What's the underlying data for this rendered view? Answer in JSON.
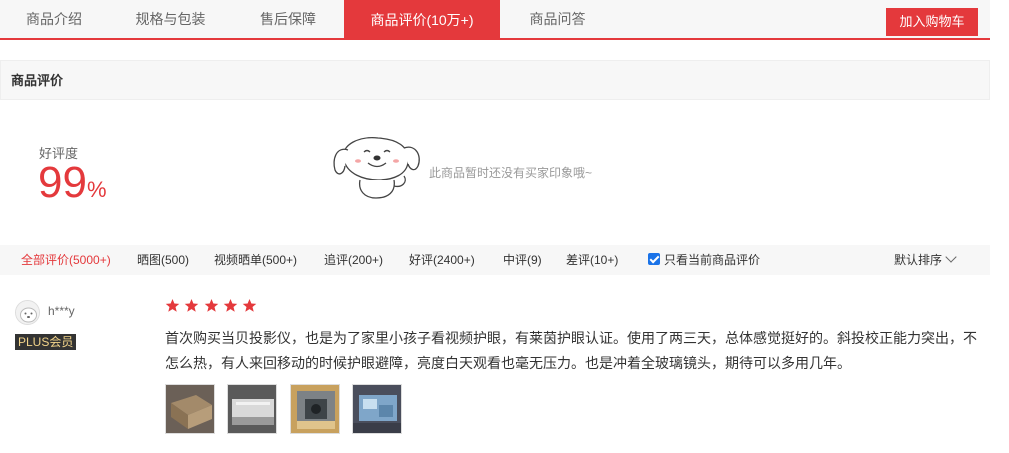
{
  "tabs": [
    {
      "label": "商品介绍"
    },
    {
      "label": "规格与包装"
    },
    {
      "label": "售后保障"
    },
    {
      "label": "商品评价(10万+)"
    },
    {
      "label": "商品问答"
    }
  ],
  "cart_button": "加入购物车",
  "section_title": "商品评价",
  "rating": {
    "label": "好评度",
    "value": "99",
    "unit": "%"
  },
  "impression_text": "此商品暂时还没有买家印象哦~",
  "filters": [
    {
      "label": "全部评价(5000+)"
    },
    {
      "label": "晒图(500)"
    },
    {
      "label": "视频晒单(500+)"
    },
    {
      "label": "追评(200+)"
    },
    {
      "label": "好评(2400+)"
    },
    {
      "label": "中评(9)"
    },
    {
      "label": "差评(10+)"
    }
  ],
  "only_current_label": "只看当前商品评价",
  "sort_label": "默认排序",
  "review": {
    "username": "h***y",
    "badge": "PLUS会员",
    "stars": 5,
    "text": "首次购买当贝投影仪，也是为了家里小孩子看视频护眼，有莱茵护眼认证。使用了两三天，总体感觉挺好的。斜投校正能力突出，不怎么热，有人来回移动的时候护眼避障，亮度白天观看也毫无压力。也是冲着全玻璃镜头，期待可以多用几年。",
    "photo_count": 4
  },
  "colors": {
    "accent": "#e4393c",
    "tab_bg": "#f7f7f7",
    "checkbox": "#1a73e8"
  }
}
